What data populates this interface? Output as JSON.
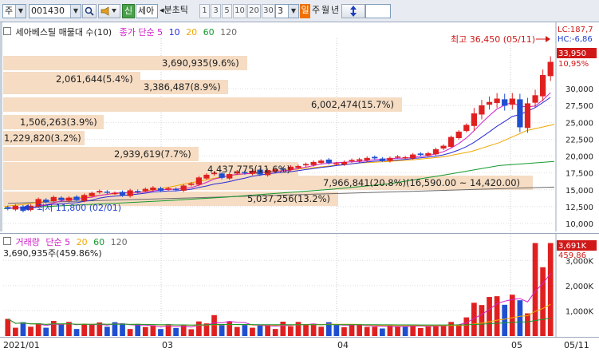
{
  "toolbar": {
    "market_label": "주",
    "code_value": "001430",
    "badge_new": "신",
    "stock_name": "세아",
    "step_label": "◂분초틱",
    "periods": [
      "1",
      "3",
      "5",
      "10",
      "20",
      "30"
    ],
    "count_value": "3",
    "period_badge": "일",
    "period_options": [
      "주",
      "월",
      "년"
    ]
  },
  "price_panel": {
    "legend_title": "세아베스틸 매물대 수(10)",
    "legend_ma_label": "종가 단순",
    "ma_periods": [
      "5",
      "10",
      "20",
      "60",
      "120"
    ],
    "lc_label": "LC:187,7",
    "hc_label": "HC:-6,86",
    "current_price_tag": "33,950",
    "pct_tag": "10,95%",
    "high_annotation": "최고 36,450 (05/11)",
    "low_annotation": "최저 11,800 (02/01)",
    "y_ticks": [
      "30,000",
      "27,500",
      "25,000",
      "22,500",
      "20,000",
      "17,500",
      "15,000",
      "12,500",
      "10,000"
    ],
    "volume_profile_labels": [
      "3,690,935(9.6%)",
      "2,061,644(5.4%)",
      "3,386,487(8.9%)",
      "6,002,474(15.7%)",
      "1,506,263(3.9%)",
      "1,229,820(3.2%)",
      "2,939,619(7.7%)",
      "4,437,775(11.6%)",
      "7,966,841(20.8%)(16,590.00 ~ 14,420.00)",
      "5,037,256(13.2%)"
    ]
  },
  "volume_panel": {
    "legend_title": "거래량",
    "legend_ma_label": "단순",
    "ma_periods": [
      "5",
      "20",
      "60",
      "120"
    ],
    "info_line": "3,690,935주(459.86%)",
    "current_volume_tag": "3,691K",
    "pct_tag": "459.86",
    "y_ticks": [
      "3,000K",
      "2,000K",
      "1,000K"
    ]
  },
  "x_axis": {
    "labels": [
      "2021/01",
      "03",
      "04",
      "05",
      "05/11"
    ]
  },
  "chart_data": {
    "type": "candlestick",
    "series_note": "daily OHLC approx",
    "closes": [
      12200,
      12600,
      11900,
      12600,
      13600,
      13200,
      13900,
      13500,
      13800,
      13500,
      14200,
      14500,
      14800,
      14600,
      14500,
      14200,
      14900,
      14700,
      15100,
      15300,
      14900,
      15200,
      15000,
      15600,
      15900,
      16800,
      17200,
      17500,
      16800,
      17300,
      17700,
      17500,
      17800,
      17300,
      17900,
      18000,
      18100,
      18400,
      18500,
      18800,
      19100,
      19300,
      19000,
      18900,
      19100,
      19400,
      19500,
      19700,
      19700,
      19400,
      19700,
      19900,
      19800,
      20200,
      20200,
      20400,
      21000,
      21500,
      22800,
      23600,
      24600,
      26300,
      27500,
      28000,
      28500,
      27500,
      28500,
      24300,
      27800,
      29000,
      32000,
      33950
    ],
    "volume_k": [
      680,
      330,
      550,
      370,
      510,
      330,
      600,
      470,
      560,
      280,
      480,
      480,
      540,
      370,
      550,
      500,
      280,
      480,
      360,
      420,
      280,
      470,
      320,
      450,
      270,
      580,
      500,
      830,
      440,
      580,
      360,
      470,
      330,
      420,
      460,
      280,
      570,
      390,
      560,
      470,
      440,
      370,
      550,
      440,
      350,
      470,
      440,
      360,
      370,
      300,
      450,
      390,
      390,
      440,
      320,
      380,
      440,
      440,
      560,
      440,
      740,
      1320,
      1230,
      1550,
      1580,
      1240,
      1640,
      1420,
      900,
      3690,
      2730,
      3690
    ],
    "ma_colors": {
      "5": "#d020c8",
      "10": "#2b2bd6",
      "20": "#f0a800",
      "60": "#139a2e",
      "120": "#6a6a6a"
    },
    "up_color": "#e02020",
    "down_color": "#1f4fd0",
    "volume_profile_color": "#f5dcc3",
    "y_range": [
      10000,
      37000
    ],
    "volume_range_k": [
      0,
      3800
    ]
  }
}
